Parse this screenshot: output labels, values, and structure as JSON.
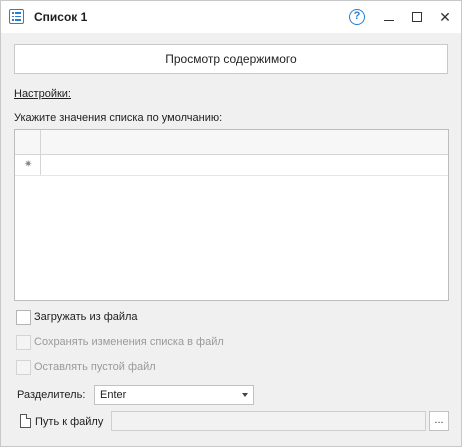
{
  "window": {
    "title": "Список 1",
    "help_glyph": "?",
    "close_glyph": "✕"
  },
  "main": {
    "view_button_label": "Просмотр содержимого",
    "settings_label": "Настройки:",
    "default_values_hint": "Укажите значения списка по умолчанию:",
    "new_row_marker": "✷"
  },
  "options": [
    {
      "label": "Загружать из файла",
      "checked": false,
      "enabled": true
    },
    {
      "label": "Сохранять изменения списка в файл",
      "checked": false,
      "enabled": false
    },
    {
      "label": "Оставлять пустой файл",
      "checked": false,
      "enabled": false
    }
  ],
  "separator": {
    "label": "Разделитель:",
    "value": "Enter"
  },
  "file_path": {
    "label": "Путь к файлу",
    "value": "",
    "browse_label": "..."
  },
  "colors": {
    "accent": "#2a7dd1",
    "background": "#f0f0f0"
  }
}
